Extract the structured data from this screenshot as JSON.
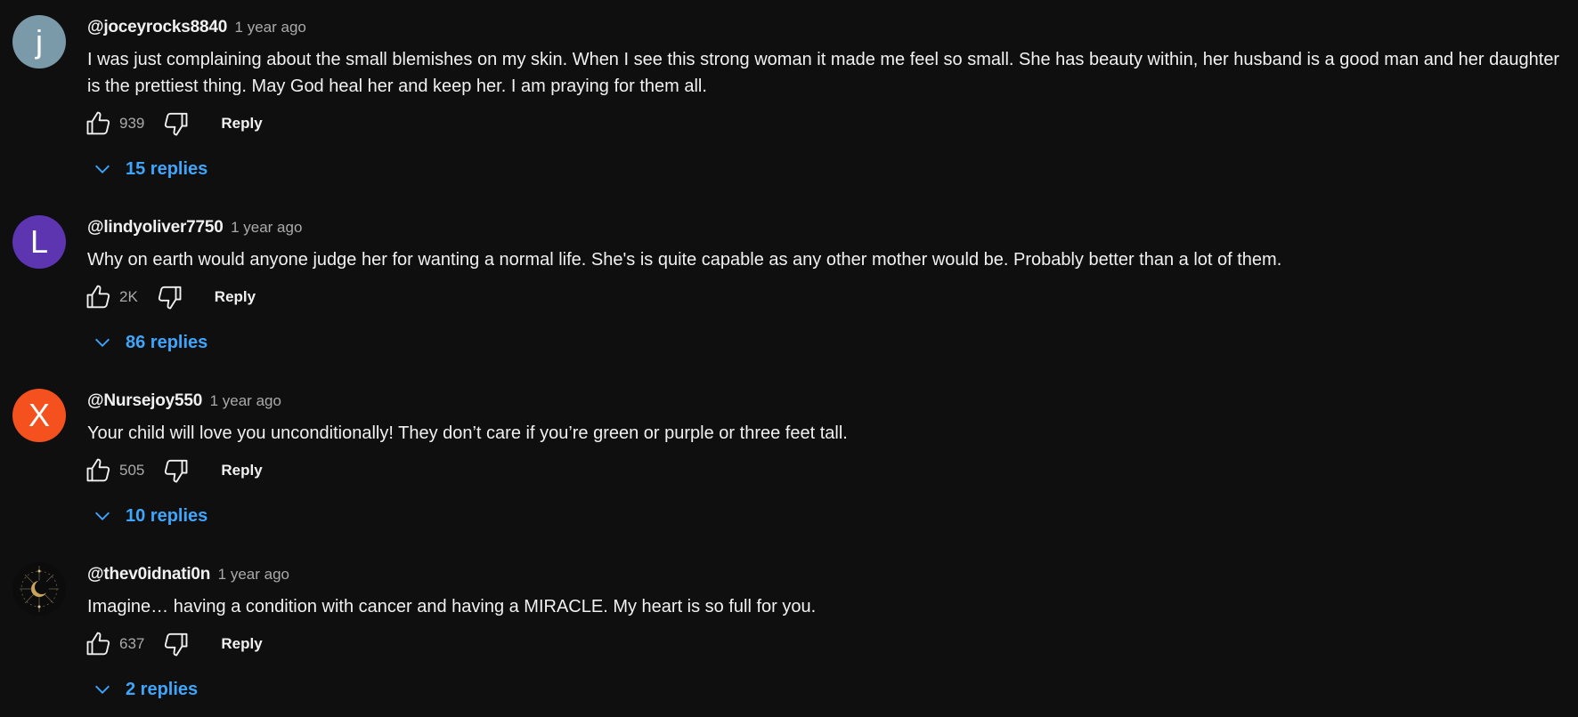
{
  "colors": {
    "background": "#0f0f0f",
    "text": "#f1f1f1",
    "muted": "#aaaaaa",
    "link": "#3ea6ff"
  },
  "reply_label": "Reply",
  "comments": [
    {
      "avatar": {
        "letter": "j",
        "color": "#7b9aa9"
      },
      "author": "@joceyrocks8840",
      "time": "1 year ago",
      "text": "I was just complaining about the small blemishes on my skin. When I see this strong woman it made me feel so small. She has beauty within, her husband is a good man and her daughter is the prettiest thing. May God heal her and keep her. I am praying for them all.",
      "likes": "939",
      "replies": "15 replies"
    },
    {
      "avatar": {
        "letter": "L",
        "color": "#5e35b1"
      },
      "author": "@lindyoliver7750",
      "time": "1 year ago",
      "text": "Why on earth would anyone judge her for wanting a normal life. She's is quite capable as any other mother would be. Probably better than a lot of them.",
      "likes": "2K",
      "replies": "86 replies"
    },
    {
      "avatar": {
        "letter": "X",
        "color": "#f4511e"
      },
      "author": "@Nursejoy550",
      "time": "1 year ago",
      "text": "Your child will love you unconditionally! They don’t care if you’re green or purple or three feet tall.",
      "likes": "505",
      "replies": "10 replies"
    },
    {
      "avatar": {
        "letter": "",
        "color": "#111111",
        "image": "moon-sun-emblem"
      },
      "author": "@thev0idnati0n",
      "time": "1 year ago",
      "text": "Imagine… having a condition with cancer and having a MIRACLE. My heart is so full for you.",
      "likes": "637",
      "replies": "2 replies"
    }
  ]
}
